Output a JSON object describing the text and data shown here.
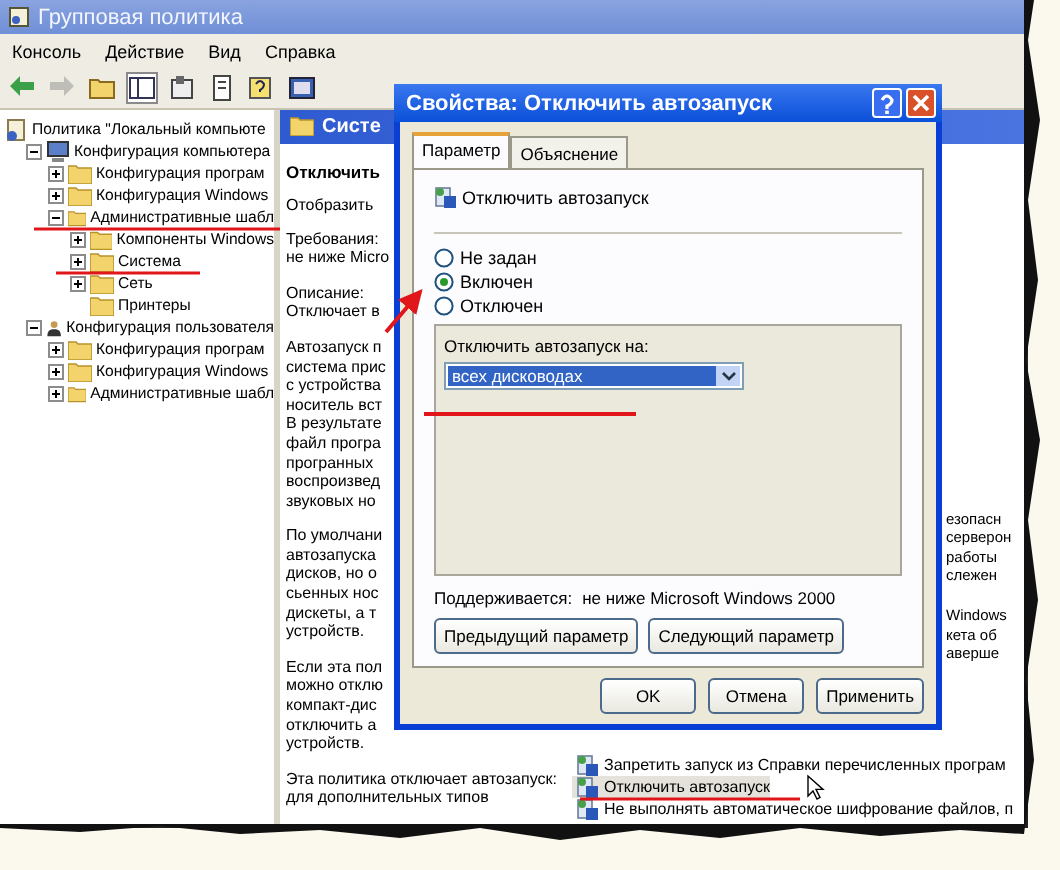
{
  "window": {
    "title": "Групповая политика"
  },
  "menu": [
    "Консоль",
    "Действие",
    "Вид",
    "Справка"
  ],
  "toolbar": [
    {
      "kind": "back",
      "disabled": false,
      "pressed": false
    },
    {
      "kind": "forward",
      "disabled": true,
      "pressed": false
    },
    {
      "kind": "up",
      "disabled": false,
      "pressed": false
    },
    {
      "kind": "tree",
      "disabled": false,
      "pressed": true
    },
    {
      "kind": "properties",
      "disabled": false,
      "pressed": false
    },
    {
      "kind": "export",
      "disabled": false,
      "pressed": false
    },
    {
      "kind": "help",
      "disabled": false,
      "pressed": false
    },
    {
      "kind": "console",
      "disabled": false,
      "pressed": false
    }
  ],
  "tree": {
    "label": "Политика \"Локальный компьюте",
    "kind": "root",
    "children": [
      {
        "label": "Конфигурация компьютера",
        "kind": "computer",
        "expanded": true,
        "children": [
          {
            "label": "Конфигурация програм",
            "kind": "folder",
            "expanded": false
          },
          {
            "label": "Конфигурация Windows",
            "kind": "folder",
            "expanded": false
          },
          {
            "label": "Административные шабл",
            "kind": "folder",
            "expanded": true,
            "children": [
              {
                "label": "Компоненты Windows",
                "kind": "folder",
                "expanded": false
              },
              {
                "label": "Система",
                "kind": "folder",
                "expanded": false
              },
              {
                "label": "Сеть",
                "kind": "folder",
                "expanded": false
              },
              {
                "label": "Принтеры",
                "kind": "plain"
              }
            ]
          }
        ]
      },
      {
        "label": "Конфигурация пользователя",
        "kind": "user",
        "expanded": true,
        "children": [
          {
            "label": "Конфигурация програм",
            "kind": "folder",
            "expanded": false
          },
          {
            "label": "Конфигурация Windows",
            "kind": "folder",
            "expanded": false
          },
          {
            "label": "Административные шабл",
            "kind": "folder",
            "expanded": false
          }
        ]
      }
    ]
  },
  "pane_header": {
    "title": "Систе"
  },
  "description": {
    "title": "Отключить",
    "link": "Отобразить",
    "paragraphs": [
      {
        "lines": [
          "Требования:",
          "не ниже Micro"
        ]
      },
      {
        "lines": [
          "Описание:",
          "Отключает в"
        ]
      },
      {
        "lines": [
          "Автозапуск п",
          "система прис",
          "с устройства",
          "носитель вст",
          "В результате",
          "файл програ",
          "програнных",
          "воспроизвед",
          "звуковых но"
        ]
      },
      {
        "lines": [
          "По умолчани",
          "автозапуска",
          "дисков, но о",
          "сьенных нос",
          "дискеты, а т",
          "устройств."
        ]
      },
      {
        "lines": [
          "Если эта пол",
          "можно отклю",
          "компакт-дис",
          "отключить а",
          "устройств."
        ]
      },
      {
        "lines": [
          "Эта политика отключает автозапуск:",
          "для дополнительных типов"
        ]
      }
    ]
  },
  "policy_fragments": [
    {
      "lines": [
        "езопасн",
        "серверон",
        "работы",
        "слежен"
      ]
    },
    {
      "lines": [
        "Windows",
        "кета об",
        "аверше"
      ]
    }
  ],
  "policies": [
    {
      "label": "Запретить запуск из Справки перечисленных програм",
      "selected": false
    },
    {
      "label": "Отключить автозапуск",
      "selected": true
    },
    {
      "label": "Не выполнять автоматическое шифрование файлов, п",
      "selected": false
    }
  ],
  "dialog": {
    "title": "Свойства: Отключить автозапуск",
    "tabs": [
      {
        "label": "Параметр",
        "selected": true
      },
      {
        "label": "Объяснение",
        "selected": false
      }
    ],
    "policy_name": "Отключить автозапуск",
    "options": [
      {
        "label": "Не задан",
        "selected": false
      },
      {
        "label": "Включен",
        "selected": true
      },
      {
        "label": "Отключен",
        "selected": false
      }
    ],
    "group_label": "Отключить автозапуск на:",
    "dropdown": {
      "value": "всех дисководах"
    },
    "supported_label": "Поддерживается:",
    "supported_value": "не ниже Microsoft Windows 2000",
    "nav_buttons": [
      "Предыдущий параметр",
      "Следующий параметр"
    ],
    "buttons": [
      "OK",
      "Отмена",
      "Применить"
    ]
  }
}
